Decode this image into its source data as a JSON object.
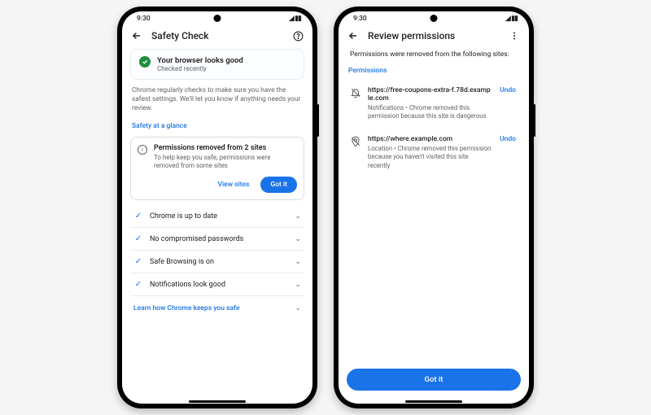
{
  "status_time": "9:30",
  "left": {
    "title": "Safety Check",
    "banner_title": "Your browser looks good",
    "banner_sub": "Checked recently",
    "body": "Chrome regularly checks to make sure you have the safest settings. We'll let you know if anything needs your review.",
    "safety_glance_label": "Safety at a glance",
    "perm_card_title": "Permissions removed from 2 sites",
    "perm_card_body": "To help keep you safe, permissions were removed from some sites",
    "view_sites_label": "View sites",
    "got_it_label": "Got it",
    "items": [
      "Chrome is up to date",
      "No compromised passwords",
      "Safe Browsing is on",
      "Notifications look good"
    ],
    "learn_more": "Learn how Chrome keeps you safe"
  },
  "right": {
    "title": "Review permissions",
    "subhead": "Permissions were removed from the following sites:",
    "section_label": "Permissions",
    "items": [
      {
        "host": "https://free-coupons-extra-f.78d.example.com",
        "desc": "Notifications • Chrome removed this permission because this site is dangerous"
      },
      {
        "host": "https://where.example.com",
        "desc": "Location • Chrome removed this permission because you haven't visited this site recently"
      }
    ],
    "undo_label": "Undo",
    "got_it_label": "Got it"
  }
}
